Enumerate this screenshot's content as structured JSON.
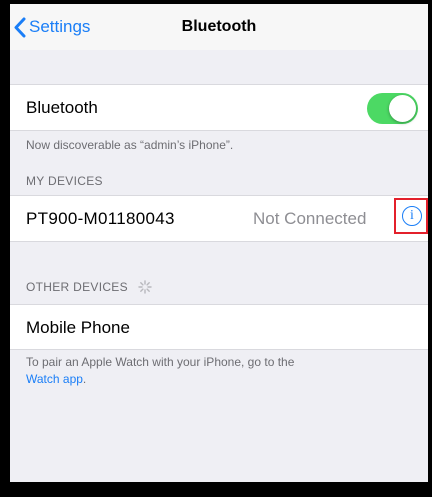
{
  "nav": {
    "back_label": "Settings",
    "title": "Bluetooth"
  },
  "bluetooth": {
    "label": "Bluetooth",
    "enabled": true,
    "discoverable_note": "Now discoverable as “admin’s iPhone”."
  },
  "my_devices": {
    "header": "MY DEVICES",
    "items": [
      {
        "name": "PT900-M01180043",
        "status": "Not Connected",
        "info_icon": "i"
      }
    ]
  },
  "other_devices": {
    "header": "OTHER DEVICES",
    "spinner_icon": "activity-spinner",
    "items": [
      {
        "name": "Mobile Phone"
      }
    ]
  },
  "pair_note": {
    "text": "To pair an Apple Watch with your iPhone, go to the",
    "link": "Watch app",
    "suffix": "."
  },
  "colors": {
    "accent": "#1a7ef7",
    "toggle_on": "#4cd964",
    "highlight_box": "#e3202b",
    "background": "#efeff4"
  }
}
